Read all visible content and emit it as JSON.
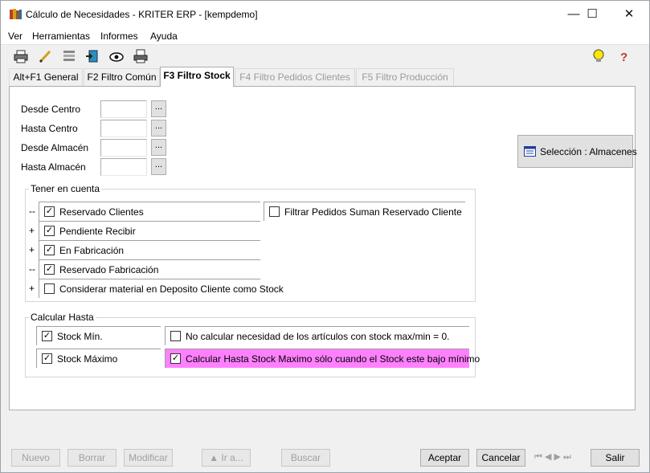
{
  "window": {
    "title": "Cálculo de Necesidades - KRITER ERP - [kempdemo]",
    "minimize_glyph": "—",
    "maximize_glyph": "☐",
    "close_glyph": "✕",
    "app_icon": "books-icon"
  },
  "menu": [
    "Ver",
    "Herramientas",
    "Informes",
    "Ayuda"
  ],
  "toolbar": {
    "icons": [
      "printer-icon",
      "pencil-icon",
      "list-icon",
      "export-icon",
      "preview-icon",
      "print-preview-icon"
    ],
    "right_icons": [
      "lightbulb-icon",
      "help-icon"
    ]
  },
  "tabs": [
    {
      "label": "Alt+F1 General",
      "state": "normal"
    },
    {
      "label": "F2 Filtro Común",
      "state": "normal"
    },
    {
      "label": "F3 Filtro Stock",
      "state": "active"
    },
    {
      "label": "F4 Filtro Pedidos Clientes",
      "state": "disabled"
    },
    {
      "label": "F5 Filtro Producción",
      "state": "disabled"
    }
  ],
  "ranges": [
    {
      "label": "Desde Centro",
      "value": "",
      "button": "..."
    },
    {
      "label": "Hasta Centro",
      "value": "",
      "button": "..."
    },
    {
      "label": "Desde Almacén",
      "value": "",
      "button": "..."
    },
    {
      "label": "Hasta Almacén",
      "value": "",
      "button": "..."
    }
  ],
  "selection_button": "Selección : Almacenes",
  "tener_en_cuenta": {
    "title": "Tener en cuenta",
    "items": [
      {
        "prefix": "--",
        "label": "Reservado Clientes",
        "checked": true
      },
      {
        "prefix": "+",
        "label": "Pendiente Recibir",
        "checked": true
      },
      {
        "prefix": "+",
        "label": "En Fabricación",
        "checked": true
      },
      {
        "prefix": "--",
        "label": "Reservado Fabricación",
        "checked": true
      },
      {
        "prefix": "+",
        "label": "Considerar material en Deposito Cliente como Stock",
        "checked": false
      }
    ],
    "filter_option": {
      "label": "Filtrar Pedidos Suman Reservado Cliente",
      "checked": false
    }
  },
  "calcular_hasta": {
    "title": "Calcular Hasta",
    "items": [
      {
        "label": "Stock Mín.",
        "checked": true
      },
      {
        "label": "Stock Máximo",
        "checked": true
      }
    ],
    "options": [
      {
        "label": "No calcular necesidad de los artículos con stock max/min = 0.",
        "checked": false,
        "highlight": ""
      },
      {
        "label": "Calcular Hasta Stock Maximo sólo cuando el Stock este bajo mínimo",
        "checked": true,
        "highlight": "#ff80ff"
      }
    ]
  },
  "bottom_buttons": {
    "nuevo": "Nuevo",
    "borrar": "Borrar",
    "modificar": "Modificar",
    "ir_a": "▲ Ir a...",
    "buscar": "Buscar",
    "aceptar": "Aceptar",
    "cancelar": "Cancelar",
    "salir": "Salir"
  },
  "nav": [
    "⏮",
    "◀",
    "▶",
    "⏭"
  ],
  "colors": {
    "highlight": "#ff80ff",
    "disabled_text": "#9a9a9a"
  }
}
